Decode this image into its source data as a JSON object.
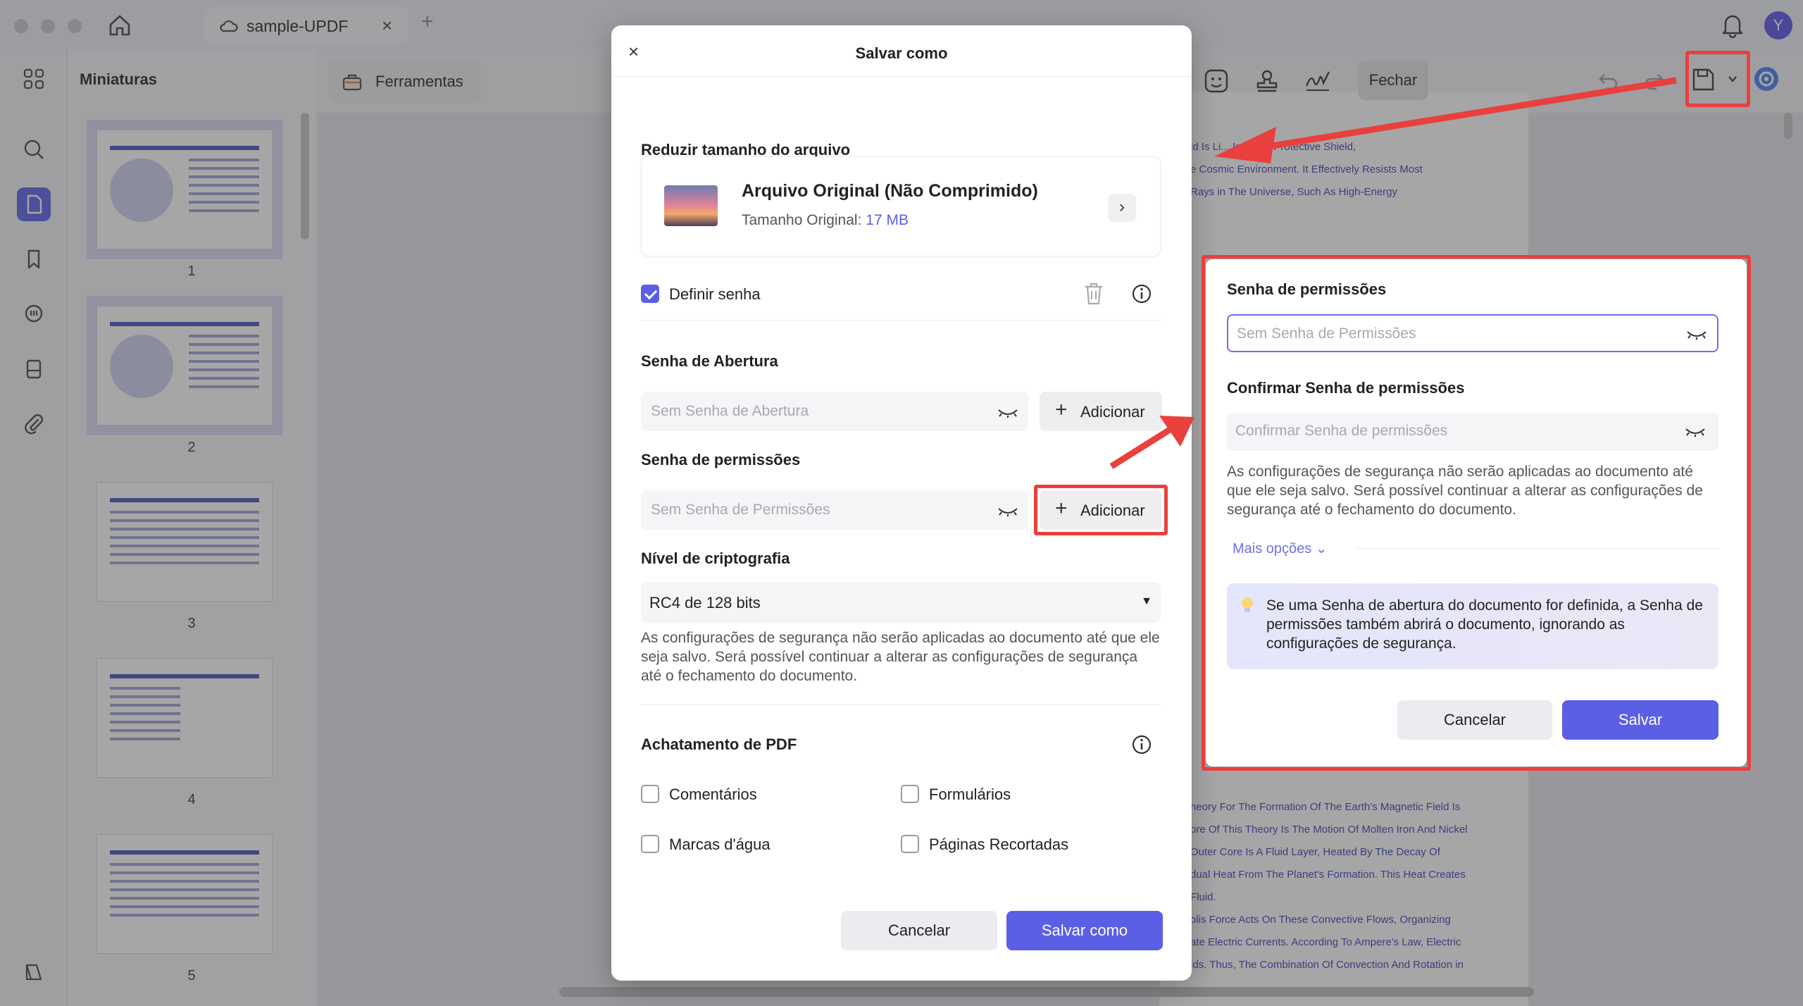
{
  "window": {
    "tab_title": "sample-UPDF",
    "tab_close": "×",
    "tab_add": "+",
    "avatar_letter": "Y"
  },
  "sidebar": {
    "thumbnails_title": "Miniaturas",
    "pages": [
      "1",
      "2",
      "3",
      "4",
      "5"
    ]
  },
  "toolbar": {
    "tools_label": "Ferramentas",
    "close_label": "Fechar"
  },
  "document": {
    "lines_top": [
      "ld Is Li... Invisible Protective Shield,",
      "e Cosmic Environment. It Effectively Resists Most",
      "Rays in The Universe, Such As High-Energy"
    ],
    "lines_bottom": [
      "heory For The Formation Of The Earth's Magnetic Field Is",
      "ore Of This Theory Is The Motion Of Molten Iron And Nickel",
      "Outer Core Is A Fluid Layer, Heated By The Decay Of",
      "dual Heat From The Planet's Formation. This Heat Creates",
      "Fluid.",
      "olis Force Acts On These Convective Flows, Organizing",
      "ate Electric Currents. According To Ampere's Law, Electric",
      "lds. Thus, The Combination Of Convection And Rotation in"
    ]
  },
  "dialog": {
    "close": "×",
    "title": "Salvar como",
    "reduce_title": "Reduzir tamanho do arquivo",
    "file_name": "Arquivo Original (Não Comprimido)",
    "size_label": "Tamanho Original: ",
    "size_value": "17 MB",
    "file_go": "›",
    "set_password_label": "Definir senha",
    "set_password_checked": true,
    "open_pw_title": "Senha de Abertura",
    "open_pw_placeholder": "Sem Senha de Abertura",
    "add_label": "Adicionar",
    "add_plus": "+",
    "perm_pw_title": "Senha de permissões",
    "perm_pw_placeholder": "Sem Senha de Permissões",
    "encryption_title": "Nível de criptografia",
    "encryption_value": "RC4 de 128 bits",
    "encryption_caret": "▼",
    "security_note": "As configurações de segurança não serão aplicadas ao documento até que ele seja salvo. Será possível continuar a alterar as configurações de segurança até o fechamento do documento.",
    "flatten_title": "Achatamento de PDF",
    "flatten_options": [
      "Comentários",
      "Formulários",
      "Marcas d'água",
      "Páginas Recortadas"
    ],
    "cancel_label": "Cancelar",
    "save_as_label": "Salvar como"
  },
  "permissions_popup": {
    "title": "Senha de permissões",
    "placeholder": "Sem Senha de Permissões",
    "confirm_title": "Confirmar Senha de permissões",
    "confirm_placeholder": "Confirmar Senha de permissões",
    "note": "As configurações de segurança não serão aplicadas ao documento até que ele seja salvo. Será possível continuar a alterar as configurações de segurança até o fechamento do documento.",
    "more_options": "Mais opções ⌄",
    "tip": "Se uma Senha de abertura do documento for definida, a Senha de permissões também abrirá o documento, ignorando as configurações de segurança.",
    "cancel_label": "Cancelar",
    "save_label": "Salvar"
  },
  "colors": {
    "accent": "#5b5fe6",
    "highlight": "#e8403c"
  }
}
